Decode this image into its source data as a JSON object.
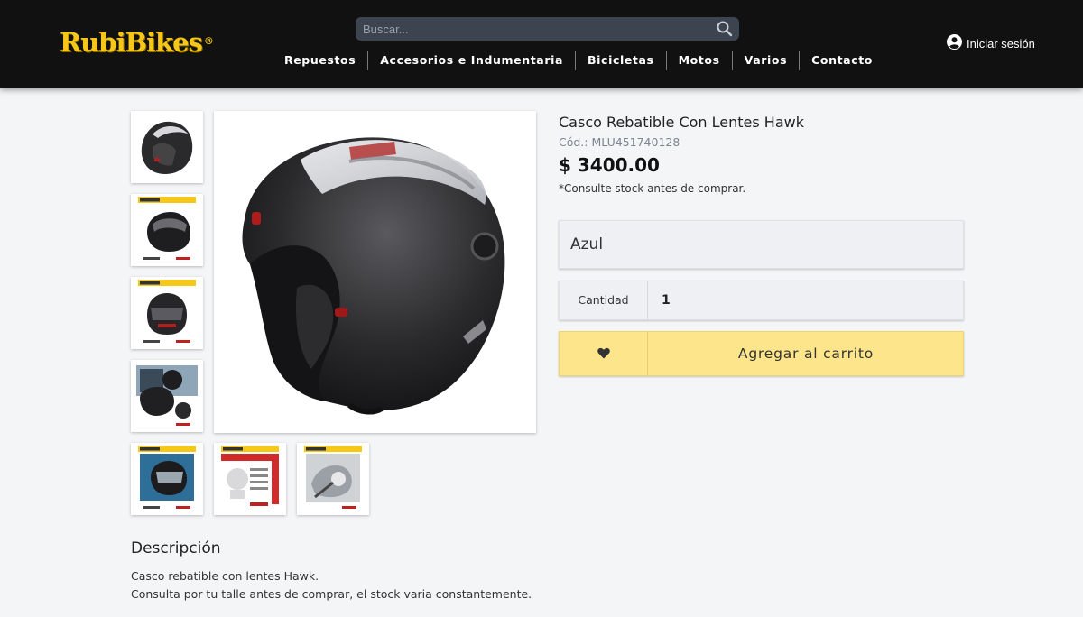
{
  "header": {
    "logo_text": "RubiBikes",
    "logo_mark": "®",
    "search": {
      "placeholder": "Buscar...",
      "icon": "search-icon"
    },
    "nav": [
      "Repuestos",
      "Accesorios e Indumentaria",
      "Bicicletas",
      "Motos",
      "Varios",
      "Contacto"
    ],
    "login": {
      "label": "Iniciar sesión",
      "icon": "user-circle-icon"
    }
  },
  "gallery": {
    "thumbnails": [
      "helmet-thumb-1",
      "helmet-thumb-2",
      "helmet-thumb-3",
      "helmet-thumb-4",
      "helmet-thumb-5",
      "helmet-thumb-6",
      "helmet-thumb-7"
    ],
    "main_image": "helmet-main-image"
  },
  "product": {
    "title": "Casco Rebatible Con Lentes Hawk",
    "code": "Cód.: MLU451740128",
    "price": "$ 3400.00",
    "stock_note": "*Consulte stock antes de comprar.",
    "variant": "Azul",
    "quantity_label": "Cantidad",
    "quantity_value": "1",
    "favorite_icon": "heart-icon",
    "add_to_cart": "Agregar al carrito"
  },
  "description": {
    "title": "Descripción",
    "lines": [
      "Casco rebatible con lentes Hawk.",
      "Consulta por tu talle antes de comprar, el stock varia constantemente."
    ]
  },
  "colors": {
    "header_bg": "#111111",
    "brand_yellow": "#f6c718",
    "cart_button": "#fce58a",
    "page_bg": "#f4f5f7"
  }
}
